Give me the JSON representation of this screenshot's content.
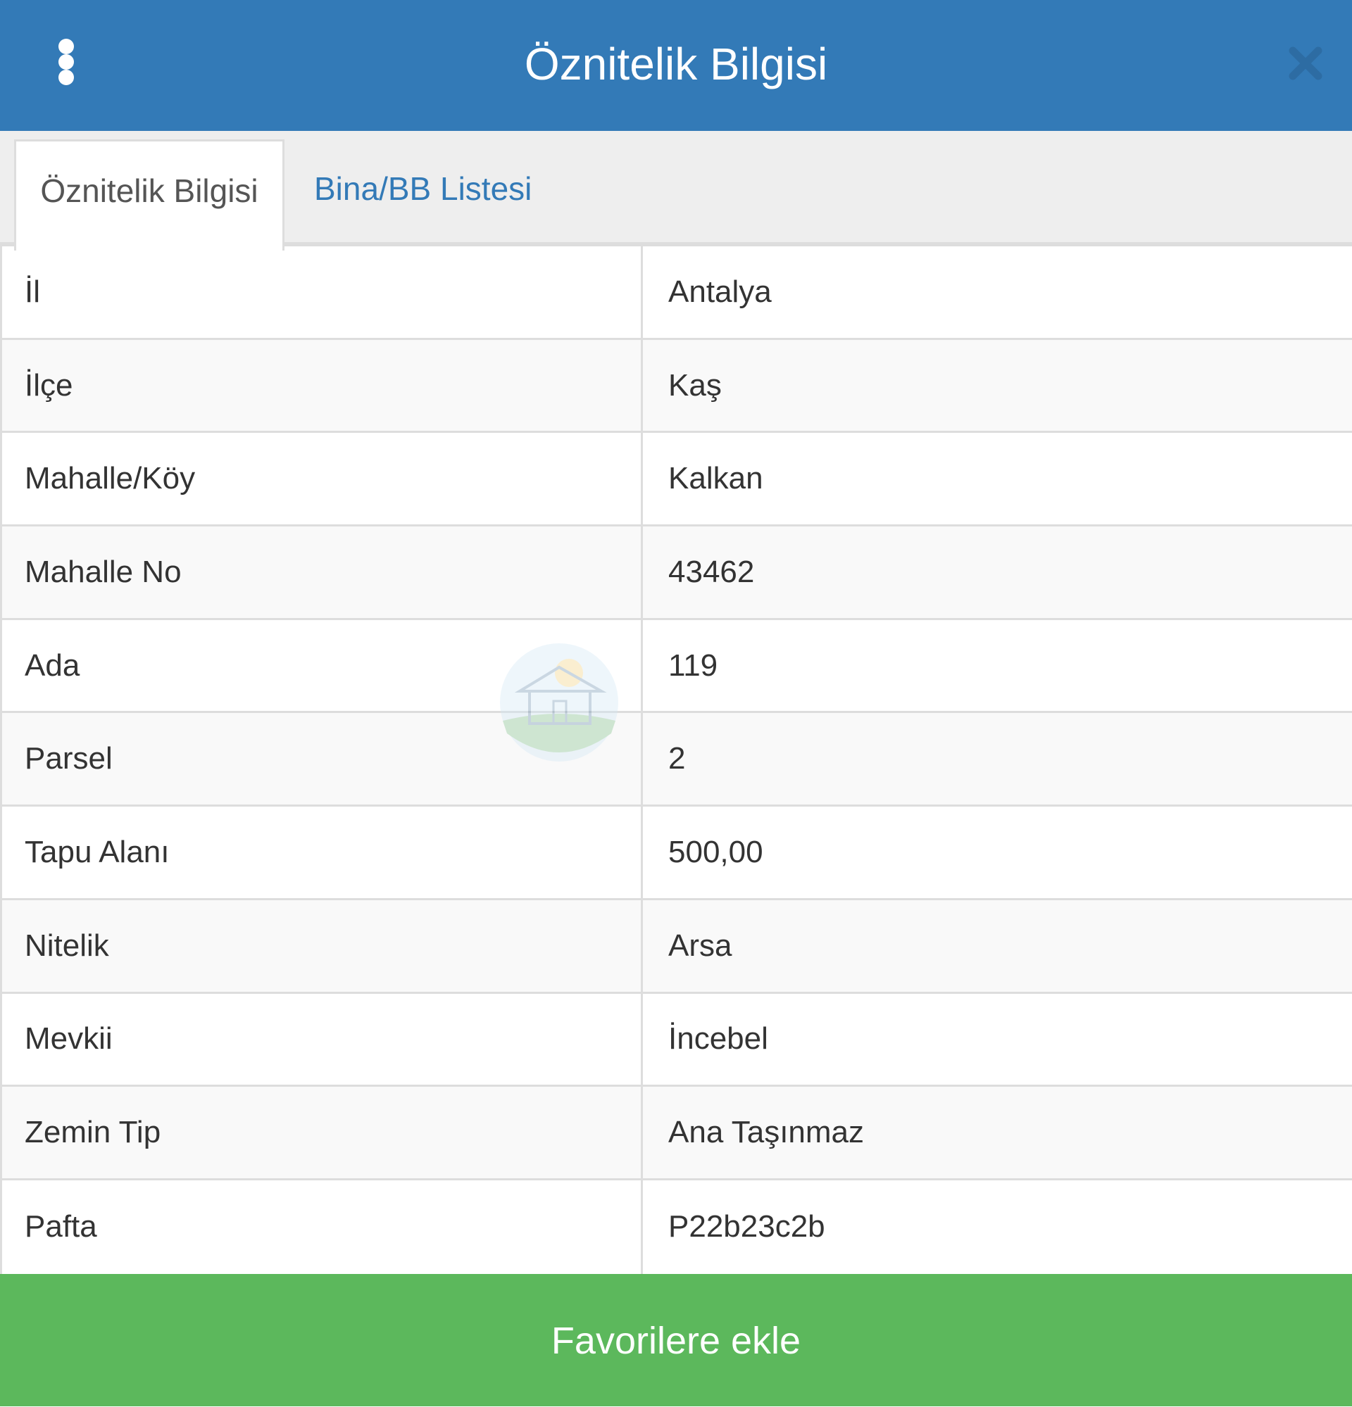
{
  "header": {
    "title": "Öznitelik Bilgisi",
    "menu_icon": "kebab-menu-icon",
    "close_icon": "close-icon"
  },
  "tabs": [
    {
      "label": "Öznitelik Bilgisi",
      "active": true
    },
    {
      "label": "Bina/BB Listesi",
      "active": false
    }
  ],
  "attributes": [
    {
      "key": "İl",
      "value": "Antalya"
    },
    {
      "key": "İlçe",
      "value": "Kaş"
    },
    {
      "key": "Mahalle/Köy",
      "value": "Kalkan"
    },
    {
      "key": "Mahalle No",
      "value": "43462"
    },
    {
      "key": "Ada",
      "value": "119"
    },
    {
      "key": "Parsel",
      "value": "2"
    },
    {
      "key": "Tapu Alanı",
      "value": "500,00"
    },
    {
      "key": "Nitelik",
      "value": "Arsa"
    },
    {
      "key": "Mevkii",
      "value": "İncebel"
    },
    {
      "key": "Zemin Tip",
      "value": "Ana Taşınmaz"
    },
    {
      "key": "Pafta",
      "value": "P22b23c2b"
    }
  ],
  "footer": {
    "favorite_button_label": "Favorilere ekle"
  },
  "colors": {
    "header": "#337ab7",
    "link": "#337ab7",
    "button": "#5cb85c"
  }
}
